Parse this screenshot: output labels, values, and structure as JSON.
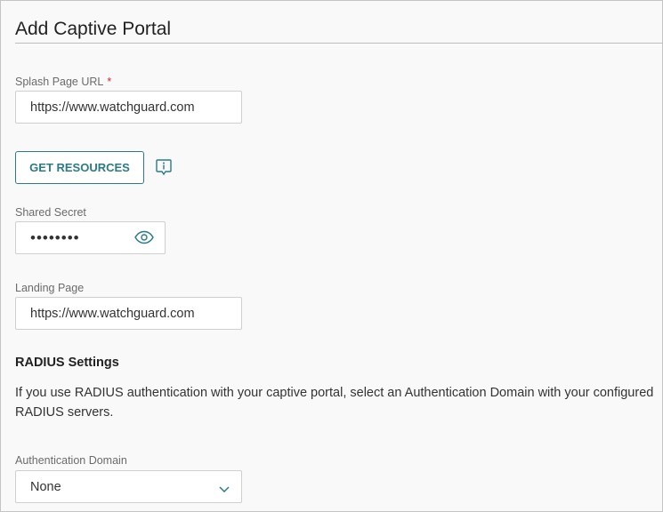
{
  "title": "Add Captive Portal",
  "splash": {
    "label": "Splash Page URL",
    "required": "*",
    "value": "https://www.watchguard.com"
  },
  "get_resources": "GET RESOURCES",
  "secret": {
    "label": "Shared Secret",
    "value": "••••••••"
  },
  "landing": {
    "label": "Landing Page",
    "value": "https://www.watchguard.com"
  },
  "radius": {
    "heading": "RADIUS Settings",
    "description": "If you use RADIUS authentication with your captive portal, select an Authentication Domain with your configured RADIUS servers."
  },
  "auth_domain": {
    "label": "Authentication Domain",
    "value": "None"
  },
  "colors": {
    "accent": "#2c7a86",
    "required": "#d9262c"
  }
}
